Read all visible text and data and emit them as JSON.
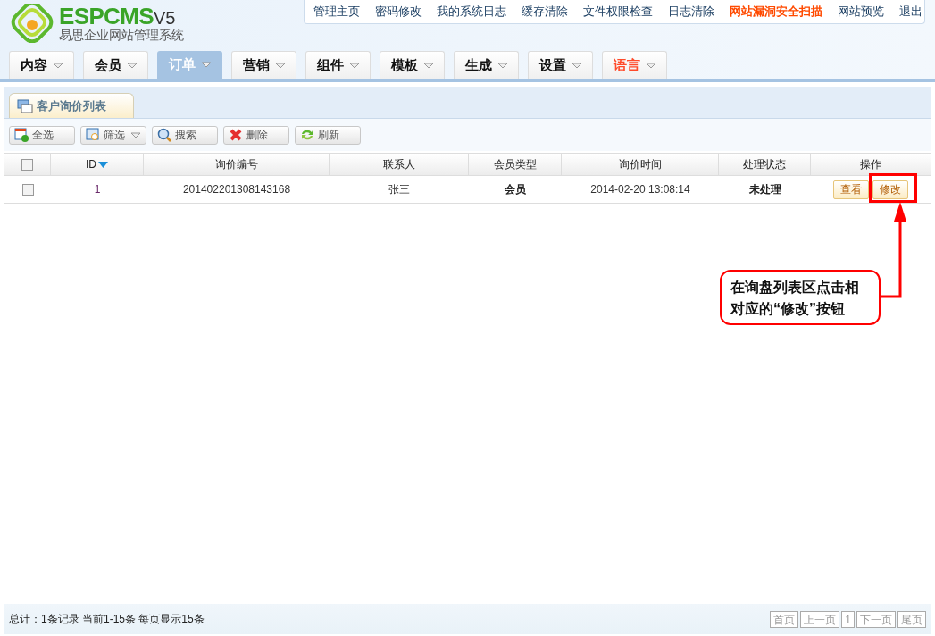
{
  "logo": {
    "brand": "ESPCMS",
    "version": "V5",
    "subtitle": "易思企业网站管理系统"
  },
  "top_links": [
    {
      "label": "管理主页",
      "highlight": false
    },
    {
      "label": "密码修改",
      "highlight": false
    },
    {
      "label": "我的系统日志",
      "highlight": false
    },
    {
      "label": "缓存清除",
      "highlight": false
    },
    {
      "label": "文件权限检查",
      "highlight": false
    },
    {
      "label": "日志清除",
      "highlight": false
    },
    {
      "label": "网站漏洞安全扫描",
      "highlight": true
    },
    {
      "label": "网站预览",
      "highlight": false
    },
    {
      "label": "退出",
      "highlight": false
    }
  ],
  "nav_tabs": [
    {
      "label": "内容",
      "selected": false,
      "highlight": false
    },
    {
      "label": "会员",
      "selected": false,
      "highlight": false
    },
    {
      "label": "订单",
      "selected": true,
      "highlight": false
    },
    {
      "label": "营销",
      "selected": false,
      "highlight": false
    },
    {
      "label": "组件",
      "selected": false,
      "highlight": false
    },
    {
      "label": "模板",
      "selected": false,
      "highlight": false
    },
    {
      "label": "生成",
      "selected": false,
      "highlight": false
    },
    {
      "label": "设置",
      "selected": false,
      "highlight": false
    },
    {
      "label": "语言",
      "selected": false,
      "highlight": true
    }
  ],
  "panel_tab": "客户询价列表",
  "toolbar": [
    {
      "label": "全选",
      "kind": "select-all"
    },
    {
      "label": "筛选",
      "kind": "filter"
    },
    {
      "label": "搜索",
      "kind": "search"
    },
    {
      "label": "删除",
      "kind": "delete"
    },
    {
      "label": "刷新",
      "kind": "refresh"
    }
  ],
  "table": {
    "select_all_checked": false,
    "columns": [
      "ID",
      "询价编号",
      "联系人",
      "会员类型",
      "询价时间",
      "处理状态",
      "操作"
    ],
    "rows": [
      {
        "checked": false,
        "id": "1",
        "number": "201402201308143168",
        "contact": "张三",
        "member_type": "会员",
        "time": "2014-02-20 13:08:14",
        "status": "未处理",
        "actions": [
          "查看",
          "修改"
        ]
      }
    ]
  },
  "annotation": "在询盘列表区点击相对应的“修改”按钮",
  "footer": {
    "summary": "总计：1条记录 当前1-15条 每页显示15条",
    "pager": [
      "首页",
      "上一页",
      "1",
      "下一页",
      "尾页"
    ]
  }
}
